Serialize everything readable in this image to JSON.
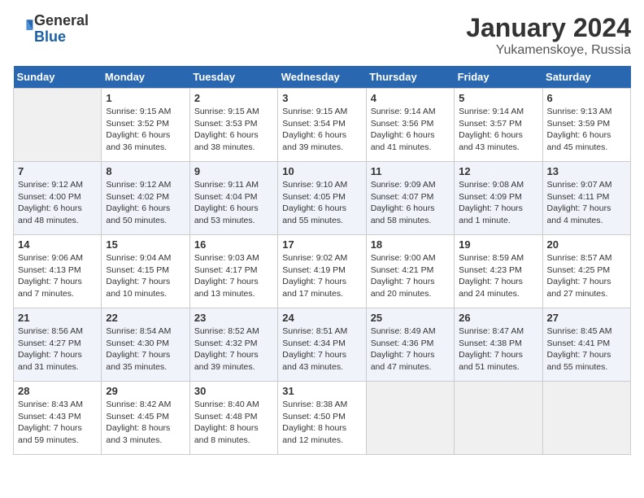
{
  "header": {
    "logo_line1": "General",
    "logo_line2": "Blue",
    "month": "January 2024",
    "location": "Yukamenskoye, Russia"
  },
  "days_of_week": [
    "Sunday",
    "Monday",
    "Tuesday",
    "Wednesday",
    "Thursday",
    "Friday",
    "Saturday"
  ],
  "weeks": [
    [
      {
        "day": "",
        "info": ""
      },
      {
        "day": "1",
        "info": "Sunrise: 9:15 AM\nSunset: 3:52 PM\nDaylight: 6 hours\nand 36 minutes."
      },
      {
        "day": "2",
        "info": "Sunrise: 9:15 AM\nSunset: 3:53 PM\nDaylight: 6 hours\nand 38 minutes."
      },
      {
        "day": "3",
        "info": "Sunrise: 9:15 AM\nSunset: 3:54 PM\nDaylight: 6 hours\nand 39 minutes."
      },
      {
        "day": "4",
        "info": "Sunrise: 9:14 AM\nSunset: 3:56 PM\nDaylight: 6 hours\nand 41 minutes."
      },
      {
        "day": "5",
        "info": "Sunrise: 9:14 AM\nSunset: 3:57 PM\nDaylight: 6 hours\nand 43 minutes."
      },
      {
        "day": "6",
        "info": "Sunrise: 9:13 AM\nSunset: 3:59 PM\nDaylight: 6 hours\nand 45 minutes."
      }
    ],
    [
      {
        "day": "7",
        "info": "Sunrise: 9:12 AM\nSunset: 4:00 PM\nDaylight: 6 hours\nand 48 minutes."
      },
      {
        "day": "8",
        "info": "Sunrise: 9:12 AM\nSunset: 4:02 PM\nDaylight: 6 hours\nand 50 minutes."
      },
      {
        "day": "9",
        "info": "Sunrise: 9:11 AM\nSunset: 4:04 PM\nDaylight: 6 hours\nand 53 minutes."
      },
      {
        "day": "10",
        "info": "Sunrise: 9:10 AM\nSunset: 4:05 PM\nDaylight: 6 hours\nand 55 minutes."
      },
      {
        "day": "11",
        "info": "Sunrise: 9:09 AM\nSunset: 4:07 PM\nDaylight: 6 hours\nand 58 minutes."
      },
      {
        "day": "12",
        "info": "Sunrise: 9:08 AM\nSunset: 4:09 PM\nDaylight: 7 hours\nand 1 minute."
      },
      {
        "day": "13",
        "info": "Sunrise: 9:07 AM\nSunset: 4:11 PM\nDaylight: 7 hours\nand 4 minutes."
      }
    ],
    [
      {
        "day": "14",
        "info": "Sunrise: 9:06 AM\nSunset: 4:13 PM\nDaylight: 7 hours\nand 7 minutes."
      },
      {
        "day": "15",
        "info": "Sunrise: 9:04 AM\nSunset: 4:15 PM\nDaylight: 7 hours\nand 10 minutes."
      },
      {
        "day": "16",
        "info": "Sunrise: 9:03 AM\nSunset: 4:17 PM\nDaylight: 7 hours\nand 13 minutes."
      },
      {
        "day": "17",
        "info": "Sunrise: 9:02 AM\nSunset: 4:19 PM\nDaylight: 7 hours\nand 17 minutes."
      },
      {
        "day": "18",
        "info": "Sunrise: 9:00 AM\nSunset: 4:21 PM\nDaylight: 7 hours\nand 20 minutes."
      },
      {
        "day": "19",
        "info": "Sunrise: 8:59 AM\nSunset: 4:23 PM\nDaylight: 7 hours\nand 24 minutes."
      },
      {
        "day": "20",
        "info": "Sunrise: 8:57 AM\nSunset: 4:25 PM\nDaylight: 7 hours\nand 27 minutes."
      }
    ],
    [
      {
        "day": "21",
        "info": "Sunrise: 8:56 AM\nSunset: 4:27 PM\nDaylight: 7 hours\nand 31 minutes."
      },
      {
        "day": "22",
        "info": "Sunrise: 8:54 AM\nSunset: 4:30 PM\nDaylight: 7 hours\nand 35 minutes."
      },
      {
        "day": "23",
        "info": "Sunrise: 8:52 AM\nSunset: 4:32 PM\nDaylight: 7 hours\nand 39 minutes."
      },
      {
        "day": "24",
        "info": "Sunrise: 8:51 AM\nSunset: 4:34 PM\nDaylight: 7 hours\nand 43 minutes."
      },
      {
        "day": "25",
        "info": "Sunrise: 8:49 AM\nSunset: 4:36 PM\nDaylight: 7 hours\nand 47 minutes."
      },
      {
        "day": "26",
        "info": "Sunrise: 8:47 AM\nSunset: 4:38 PM\nDaylight: 7 hours\nand 51 minutes."
      },
      {
        "day": "27",
        "info": "Sunrise: 8:45 AM\nSunset: 4:41 PM\nDaylight: 7 hours\nand 55 minutes."
      }
    ],
    [
      {
        "day": "28",
        "info": "Sunrise: 8:43 AM\nSunset: 4:43 PM\nDaylight: 7 hours\nand 59 minutes."
      },
      {
        "day": "29",
        "info": "Sunrise: 8:42 AM\nSunset: 4:45 PM\nDaylight: 8 hours\nand 3 minutes."
      },
      {
        "day": "30",
        "info": "Sunrise: 8:40 AM\nSunset: 4:48 PM\nDaylight: 8 hours\nand 8 minutes."
      },
      {
        "day": "31",
        "info": "Sunrise: 8:38 AM\nSunset: 4:50 PM\nDaylight: 8 hours\nand 12 minutes."
      },
      {
        "day": "",
        "info": ""
      },
      {
        "day": "",
        "info": ""
      },
      {
        "day": "",
        "info": ""
      }
    ]
  ]
}
